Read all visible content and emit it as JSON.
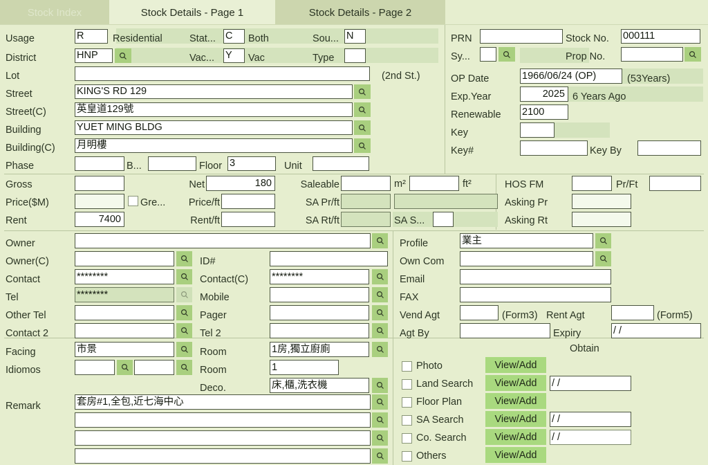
{
  "tabs": [
    {
      "label": "Stock Index",
      "state": "disabled"
    },
    {
      "label": "Stock Details - Page 1",
      "state": "active"
    },
    {
      "label": "Stock Details - Page 2",
      "state": "normal"
    }
  ],
  "left": {
    "usage": {
      "label": "Usage",
      "code": "R",
      "text": "Residential"
    },
    "stat": {
      "label": "Stat...",
      "code": "C",
      "text": "Both"
    },
    "sou": {
      "label": "Sou...",
      "code": "N"
    },
    "district": {
      "label": "District",
      "code": "HNP"
    },
    "vac": {
      "label": "Vac...",
      "code": "Y",
      "text": "Vac"
    },
    "type": {
      "label": "Type",
      "code": ""
    },
    "lot": {
      "label": "Lot",
      "value": "",
      "note": "(2nd St.)"
    },
    "street": {
      "label": "Street",
      "value": "KING'S RD 129"
    },
    "street_c": {
      "label": "Street(C)",
      "value": "英皇道129號"
    },
    "building": {
      "label": "Building",
      "value": "YUET MING BLDG"
    },
    "building_c": {
      "label": "Building(C)",
      "value": "月明樓"
    },
    "phase": {
      "label": "Phase",
      "value": ""
    },
    "block": {
      "label": "B...",
      "value": ""
    },
    "floor": {
      "label": "Floor",
      "value": "3"
    },
    "unit": {
      "label": "Unit",
      "value": ""
    }
  },
  "right": {
    "prn": {
      "label": "PRN",
      "value": ""
    },
    "stock_no": {
      "label": "Stock No.",
      "value": "000111"
    },
    "sy": {
      "label": "Sy...",
      "value": ""
    },
    "prop_no": {
      "label": "Prop No.",
      "value": ""
    },
    "op_date": {
      "label": "OP Date",
      "value": "1966/06/24 (OP)",
      "note": "(53Years)"
    },
    "exp_year": {
      "label": "Exp.Year",
      "value": "2025",
      "note": "6 Years Ago"
    },
    "renewable": {
      "label": "Renewable",
      "value": "2100"
    },
    "key": {
      "label": "Key",
      "value": ""
    },
    "key_hash": {
      "label": "Key#",
      "value": ""
    },
    "key_by": {
      "label": "Key By",
      "value": ""
    }
  },
  "area": {
    "gross": {
      "label": "Gross",
      "value": ""
    },
    "net": {
      "label": "Net",
      "value": "180"
    },
    "saleable": {
      "label": "Saleable",
      "value": "",
      "m2": "m²",
      "value2": "",
      "ft2": "ft²"
    },
    "hos_fm": {
      "label": "HOS FM",
      "value": ""
    },
    "pr_ft": {
      "label": "Pr/Ft",
      "value": ""
    },
    "price_m": {
      "label": "Price($M)",
      "value": ""
    },
    "green": {
      "label": "Gre...",
      "checked": false
    },
    "price_ft": {
      "label": "Price/ft",
      "value": ""
    },
    "sa_pr_ft": {
      "label": "SA Pr/ft",
      "value": "",
      "value2": ""
    },
    "asking_pr": {
      "label": "Asking Pr",
      "value": ""
    },
    "rent": {
      "label": "Rent",
      "value": "7400"
    },
    "rent_ft": {
      "label": "Rent/ft",
      "value": ""
    },
    "sa_rt_ft": {
      "label": "SA Rt/ft",
      "value": ""
    },
    "sa_s": {
      "label": "SA S...",
      "value": ""
    },
    "asking_rt": {
      "label": "Asking Rt",
      "value": ""
    }
  },
  "contact": {
    "owner": {
      "label": "Owner",
      "value": ""
    },
    "owner_c": {
      "label": "Owner(C)",
      "value": ""
    },
    "id": {
      "label": "ID#",
      "value": ""
    },
    "contact": {
      "label": "Contact",
      "value": "********"
    },
    "contact_c": {
      "label": "Contact(C)",
      "value": "********"
    },
    "tel": {
      "label": "Tel",
      "value": "********"
    },
    "mobile": {
      "label": "Mobile",
      "value": ""
    },
    "other_tel": {
      "label": "Other Tel",
      "value": ""
    },
    "pager": {
      "label": "Pager",
      "value": ""
    },
    "contact2": {
      "label": "Contact 2",
      "value": ""
    },
    "tel2": {
      "label": "Tel 2",
      "value": ""
    }
  },
  "agent": {
    "profile": {
      "label": "Profile",
      "value": "業主"
    },
    "own_com": {
      "label": "Own Com",
      "value": ""
    },
    "email": {
      "label": "Email",
      "value": ""
    },
    "fax": {
      "label": "FAX",
      "value": ""
    },
    "vend_agt": {
      "label": "Vend Agt",
      "value": "",
      "note": "(Form3)"
    },
    "rent_agt": {
      "label": "Rent Agt",
      "value": "",
      "note": "(Form5)"
    },
    "agt_by": {
      "label": "Agt By",
      "value": ""
    },
    "expiry": {
      "label": "Expiry",
      "value": "/ /"
    }
  },
  "detail": {
    "facing": {
      "label": "Facing",
      "value": "市景"
    },
    "room": {
      "label": "Room",
      "value": "1房,獨立廚廁"
    },
    "idiomos": {
      "label": "Idiomos",
      "value": "",
      "value2": ""
    },
    "room2": {
      "label": "Room",
      "value": "1"
    },
    "deco": {
      "label": "Deco.",
      "value": "床,櫃,洗衣機"
    },
    "remark": {
      "label": "Remark",
      "lines": [
        "套房#1,全包,近七海中心",
        "",
        "",
        ""
      ]
    }
  },
  "obtain": {
    "title": "Obtain",
    "button_label": "View/Add",
    "rows": [
      {
        "label": "Photo",
        "checked": false,
        "date": null
      },
      {
        "label": "Land Search",
        "checked": false,
        "date": "/ /"
      },
      {
        "label": "Floor Plan",
        "checked": false,
        "date": null
      },
      {
        "label": "SA Search",
        "checked": false,
        "date": "/ /"
      },
      {
        "label": "Co. Search",
        "checked": false,
        "date": "/ /"
      },
      {
        "label": "Others",
        "checked": false,
        "date": null
      }
    ]
  },
  "icons": {
    "magnifier": "search-icon"
  }
}
